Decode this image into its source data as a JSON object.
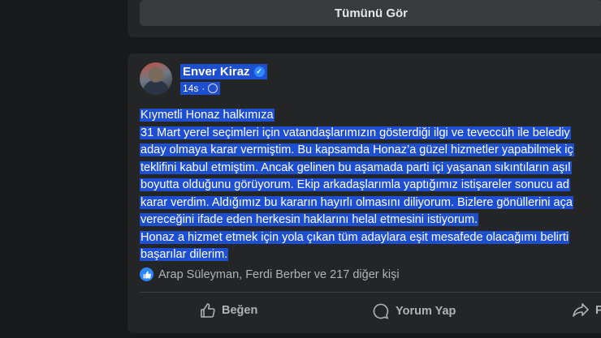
{
  "top_card": {
    "see_all_label": "Tümünü Gör"
  },
  "post": {
    "author": "Enver Kiraz",
    "time": "14s",
    "lines": [
      "Kıymetli Honaz halkımıza",
      "31 Mart yerel seçimleri için vatandaşlarımızın gösterdiği ilgi ve teveccüh ile belediy",
      "aday olmaya karar vermiştim. Bu kapsamda Honaz’a güzel hizmetler yapabilmek iç",
      "teklifini kabul etmiştim. Ancak gelinen bu aşamada parti içi yaşanan sıkıntıların aşıl",
      "boyutta olduğunu görüyorum. Ekip arkadaşlarımla yaptığımız istişareler sonucu ad",
      "karar verdim. Aldığımız bu kararın hayırlı olmasını diliyorum. Bizlere gönüllerini aça",
      "vereceğini ifade eden herkesin haklarını helal etmesini istiyorum.",
      "Honaz a hizmet etmek için yola çıkan tüm adaylara eşit mesafede olacağımı belirti",
      "başarılar dilerim."
    ],
    "reactions_text": "Arap Süleyman, Ferdi Berber ve 217 diğer kişi",
    "actions": {
      "like": "Beğen",
      "comment": "Yorum Yap",
      "share": "P"
    }
  },
  "icons": [
    "verified-badge-icon",
    "globe-icon",
    "like-reaction-icon",
    "thumbs-up-icon",
    "comment-icon",
    "share-icon"
  ]
}
